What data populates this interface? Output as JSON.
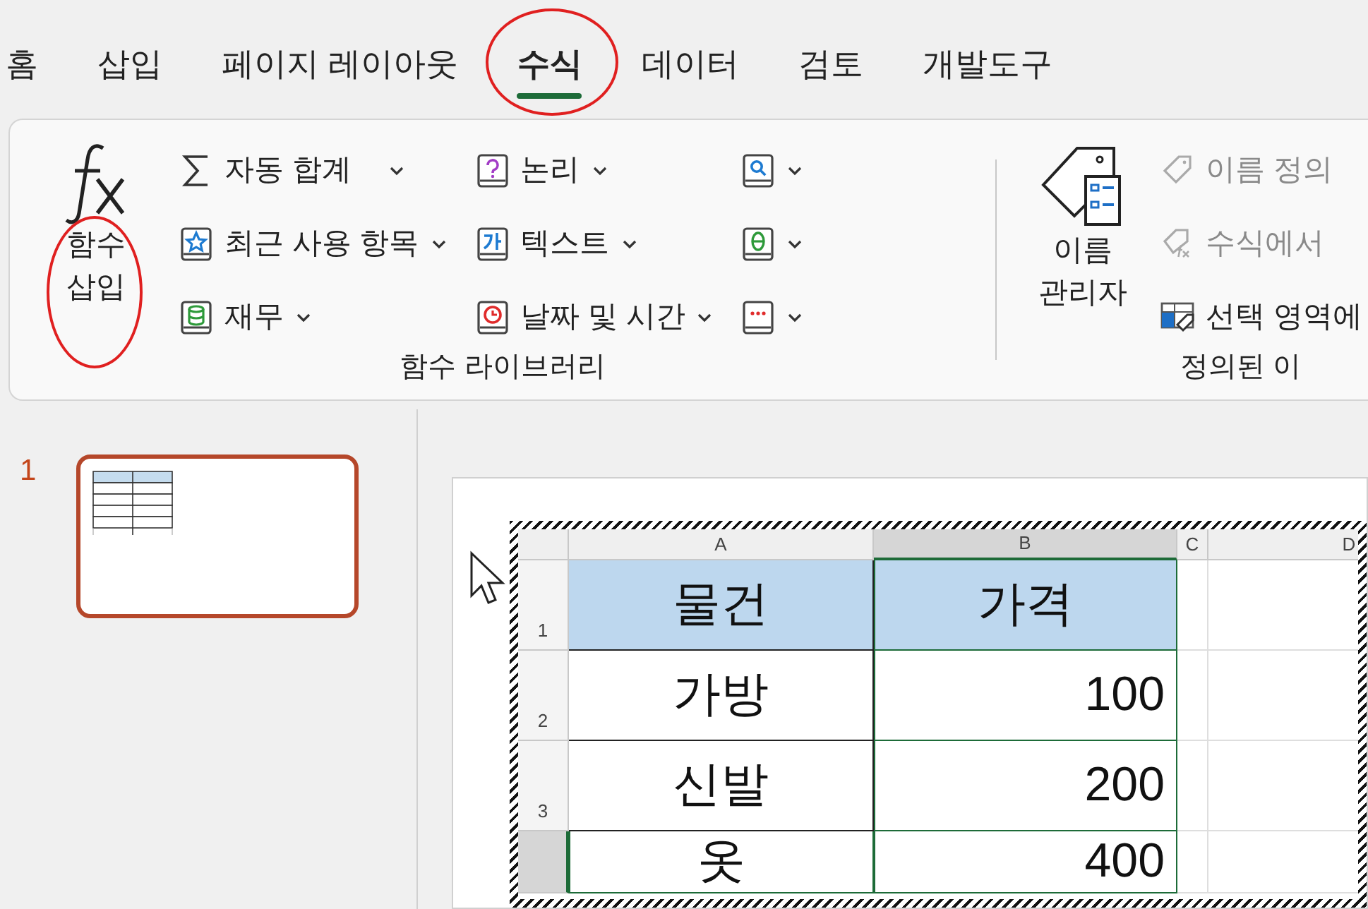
{
  "tabs": [
    {
      "label": "홈",
      "selected": false,
      "circled": false
    },
    {
      "label": "삽입",
      "selected": false,
      "circled": false
    },
    {
      "label": "페이지 레이아웃",
      "selected": false,
      "circled": false
    },
    {
      "label": "수식",
      "selected": true,
      "circled": true
    },
    {
      "label": "데이터",
      "selected": false,
      "circled": false
    },
    {
      "label": "검토",
      "selected": false,
      "circled": false
    },
    {
      "label": "개발도구",
      "selected": false,
      "circled": false
    }
  ],
  "ribbon": {
    "groups": [
      {
        "label": "함수 라이브러리",
        "large_button": {
          "label_lines": [
            "함수",
            "삽입"
          ],
          "kind": "fx",
          "circled": true
        },
        "columns": [
          [
            {
              "label": "자동 합계",
              "kind": "sum",
              "dropdown": true,
              "disabled": false
            },
            {
              "label": "최근 사용 항목",
              "kind": "star",
              "dropdown": true,
              "disabled": false
            },
            {
              "label": "재무",
              "kind": "database",
              "dropdown": true,
              "disabled": false
            }
          ],
          [
            {
              "label": "논리",
              "kind": "logic",
              "dropdown": true,
              "disabled": false
            },
            {
              "label": "텍스트",
              "kind": "text",
              "dropdown": true,
              "disabled": false
            },
            {
              "label": "날짜 및 시간",
              "kind": "clock",
              "dropdown": true,
              "disabled": false
            }
          ],
          [
            {
              "kind": "search",
              "dropdown": true,
              "disabled": false
            },
            {
              "kind": "theta",
              "dropdown": true,
              "disabled": false
            },
            {
              "kind": "more",
              "dropdown": true,
              "disabled": false
            }
          ]
        ]
      },
      {
        "label": "정의된 이",
        "large_button": {
          "label_lines": [
            "이름",
            "관리자"
          ],
          "kind": "name-manager",
          "circled": false
        },
        "columns": [
          [
            {
              "label": "이름 정의",
              "kind": "tag",
              "dropdown": false,
              "disabled": true
            },
            {
              "label": "수식에서",
              "kind": "tag-fx",
              "dropdown": false,
              "disabled": true
            },
            {
              "label": "선택 영역에",
              "kind": "table-tag",
              "dropdown": false,
              "disabled": false
            }
          ]
        ]
      }
    ]
  },
  "slides": [
    {
      "number": "1",
      "selected": true
    }
  ],
  "sheet": {
    "columns": [
      {
        "label": "A",
        "selected": false
      },
      {
        "label": "B",
        "selected": true
      },
      {
        "label": "C",
        "selected": false
      },
      {
        "label": "D",
        "selected": false
      }
    ],
    "rows": [
      {
        "number": "1",
        "selected": false,
        "header": true,
        "cells": [
          "물건",
          "가격"
        ]
      },
      {
        "number": "2",
        "selected": false,
        "header": false,
        "cells": [
          "가방",
          "100"
        ]
      },
      {
        "number": "3",
        "selected": false,
        "header": false,
        "cells": [
          "신발",
          "200"
        ]
      },
      {
        "number": "",
        "selected": true,
        "header": false,
        "cells": [
          "옷",
          "400"
        ]
      }
    ]
  }
}
